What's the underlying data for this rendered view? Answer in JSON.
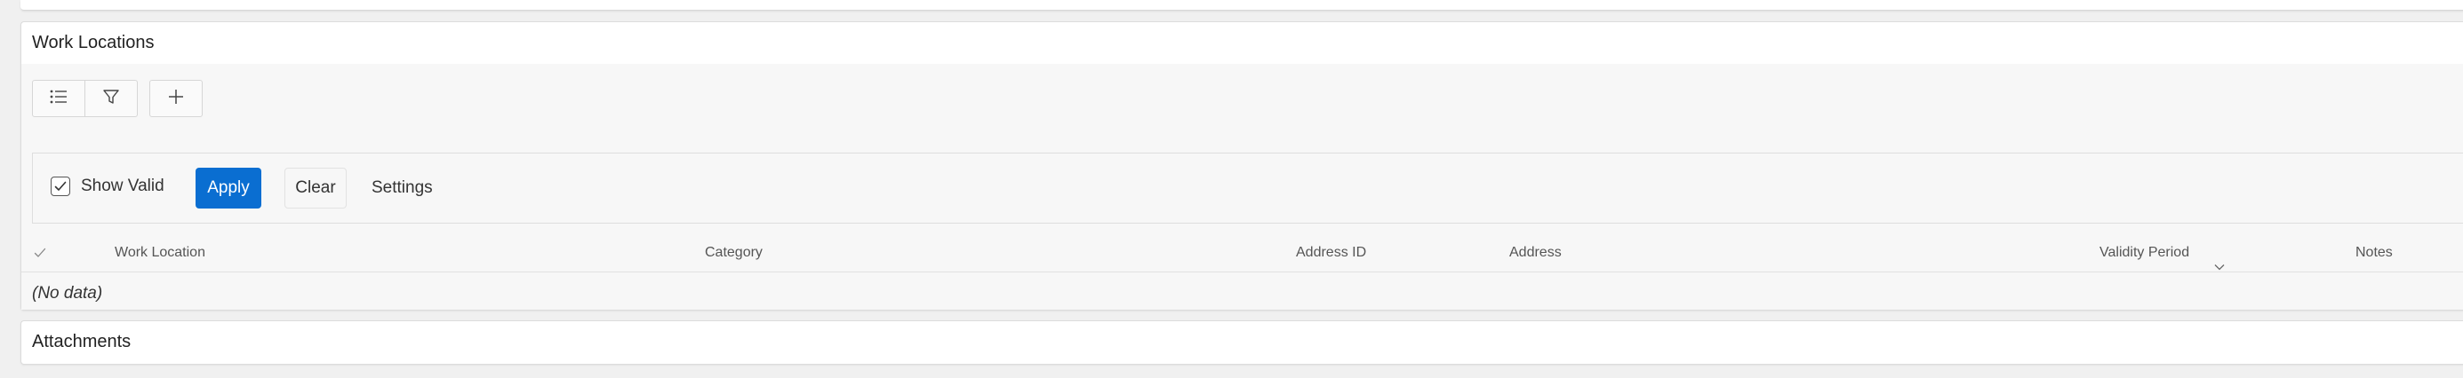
{
  "work_locations": {
    "title": "Work Locations",
    "toolbar": {
      "list_icon": "list-icon",
      "filter_icon": "filter-icon",
      "add_icon": "plus-icon"
    },
    "filter": {
      "show_valid_label": "Show Valid",
      "show_valid_checked": true,
      "apply_label": "Apply",
      "clear_label": "Clear",
      "settings_label": "Settings",
      "accent_color": "#0a6ed1"
    },
    "table": {
      "columns": [
        "Work Location",
        "Category",
        "Address ID",
        "Address",
        "Validity Period",
        "Notes"
      ],
      "sorted_column": "Validity Period",
      "no_data_text": "(No data)"
    }
  },
  "attachments": {
    "title": "Attachments"
  }
}
